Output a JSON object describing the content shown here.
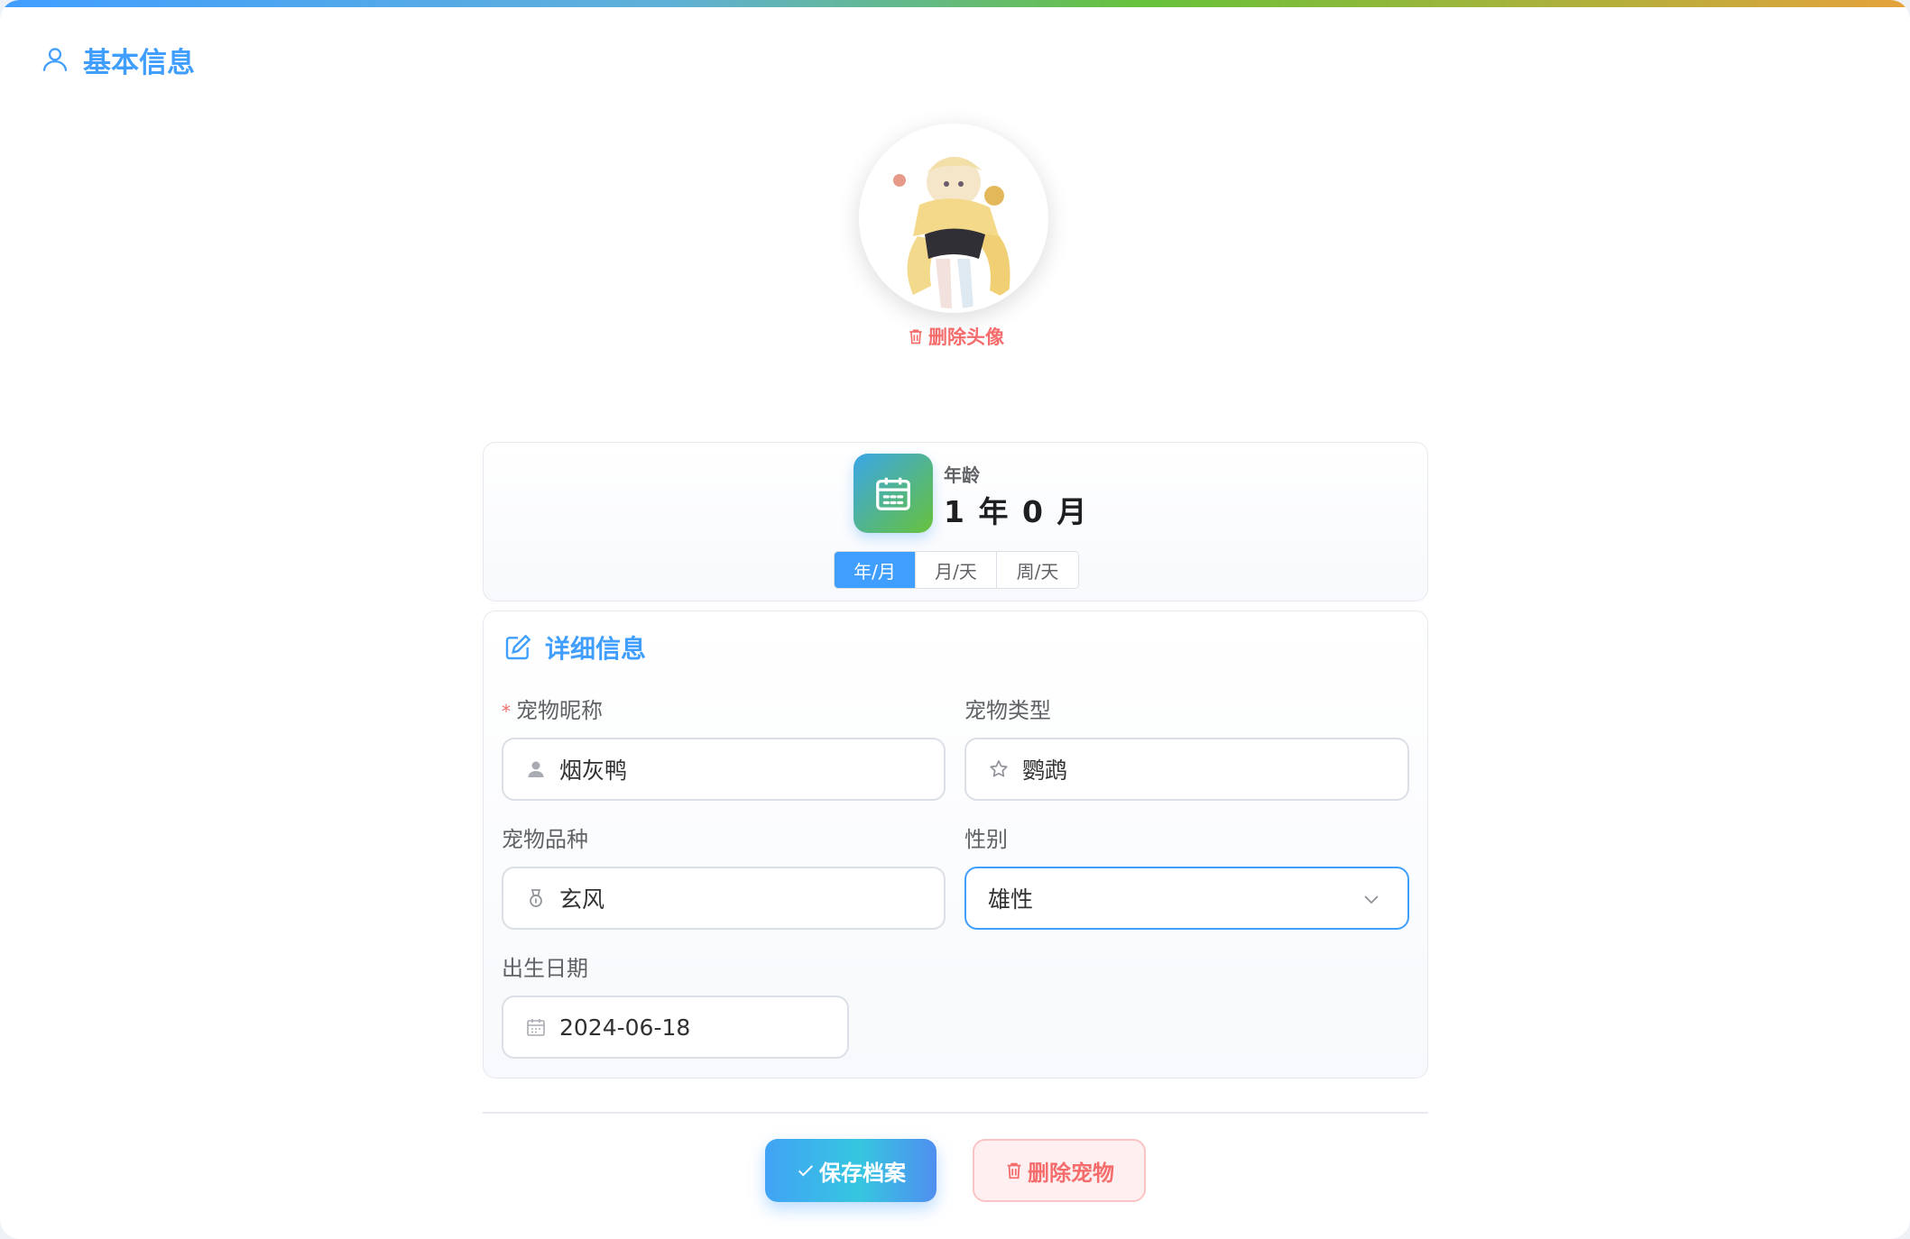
{
  "section": {
    "title": "基本信息",
    "icon": "user-icon"
  },
  "avatar": {
    "delete_label": "删除头像",
    "delete_icon": "trash-icon"
  },
  "age": {
    "label": "年龄",
    "value": "1 年 0 月",
    "icon": "calendar-icon",
    "units": [
      {
        "label": "年/月",
        "active": true
      },
      {
        "label": "月/天",
        "active": false
      },
      {
        "label": "周/天",
        "active": false
      }
    ]
  },
  "details": {
    "title": "详细信息",
    "icon": "edit-icon",
    "nickname": {
      "label": "宠物昵称",
      "required_mark": "*",
      "value": "烟灰鸭",
      "icon": "user-filled-icon"
    },
    "type": {
      "label": "宠物类型",
      "value": "鹦鹉",
      "icon": "star-icon"
    },
    "breed": {
      "label": "宠物品种",
      "value": "玄风",
      "icon": "medal-icon"
    },
    "gender": {
      "label": "性别",
      "value": "雄性",
      "icon": "chevron-down-icon"
    },
    "birthday": {
      "label": "出生日期",
      "value": "2024-06-18",
      "icon": "calendar-icon"
    }
  },
  "actions": {
    "save_label": "保存档案",
    "delete_label": "删除宠物"
  },
  "colors": {
    "primary": "#409eff",
    "danger": "#f56c6c",
    "success": "#67c23a"
  }
}
